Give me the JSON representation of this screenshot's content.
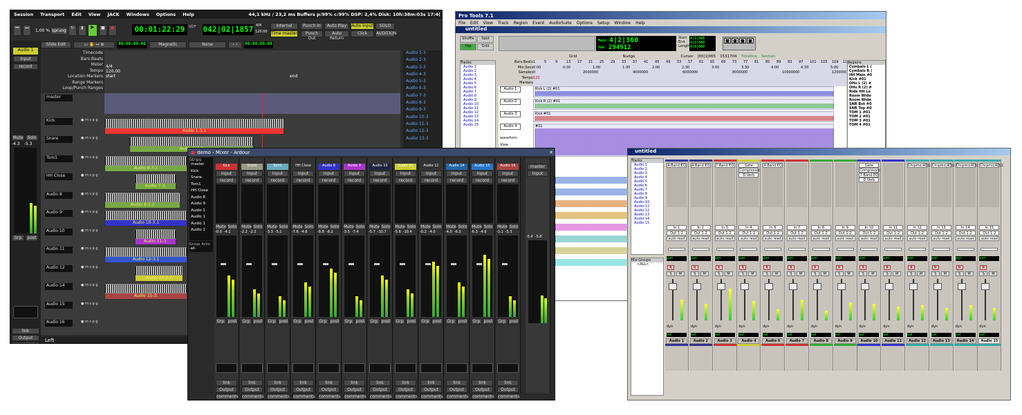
{
  "ardour": {
    "menu": [
      "Session",
      "Transport",
      "Edit",
      "View",
      "JACK",
      "Windows",
      "Options",
      "Help"
    ],
    "status": "44,1 kHz / 23,2 ms  Buffers p:99% c:99%  DSP:  2,4%  Disk: 10h:38m:03s 17:4(",
    "shuttle": "1,00 %",
    "shuttle_mode": "sprung",
    "clock1": "00:01:22:29",
    "clock2": "042|02|1857",
    "bpm_top": "4/4",
    "bpm": "120.00",
    "nudge": "NDF",
    "sync": "Internal",
    "time_master": "Time master",
    "punch_in": "Punch In",
    "punch_out": "Punch Out",
    "auto_play": "Auto Play",
    "auto_return": "Auto Return",
    "auto_input": "Auto Input",
    "click": "Click",
    "solo": "SOLO",
    "audition": "AUDITION",
    "edit_mode": "Slide Edit",
    "snap": "Magnetic",
    "snap_to": "None",
    "nudge_clock": "00:00:00:00",
    "nudge_clock2": "00:00:00:00",
    "rulers": [
      "Timecode",
      "Bars:Beats",
      "Meter",
      "Tempo",
      "Location Markers",
      "Range Markers",
      "Loop/Punch Ranges"
    ],
    "meter_val": "4/4",
    "tempo_val": "120.00",
    "start": "start",
    "end": "end",
    "tracks": [
      "master",
      "Kick",
      "Snare",
      "Tom1",
      "HH Close",
      "Audio 8",
      "Audio 9",
      "Audio 10",
      "Audio 11",
      "Audio 12",
      "Audio 14",
      "Audio 15",
      "Audio 16"
    ],
    "regions": [
      "Audio 1-3.1",
      "Audio 5-1.1",
      "Audio 6-3.1",
      "Audio 7-3.",
      "Audio 8-3.1",
      "Audio 10-3.1",
      "Audio 11-3.",
      "Audio 12-3.1",
      "Audio 14-3.1",
      "Audio 15-3."
    ],
    "side_tabs": [
      "Tracks/Busses",
      "Snapshots",
      "Edit Groups",
      "Chunks"
    ],
    "region_list": [
      "Audio 1-3",
      "Audio 2-3",
      "Audio 3-3",
      "Audio 4-3",
      "Audio 5-3",
      "Audio 6-3",
      "Audio 7-3",
      "Audio 8-3",
      "Audio 9-3",
      "Audio 10-3",
      "Audio 11-3",
      "Audio 12-3",
      "Audio 13-3"
    ],
    "left_strip": {
      "name": "Audio 1",
      "input": "Input",
      "record": "record",
      "mute": "Mute",
      "solo": "Solo",
      "gain": "-4.3",
      "peak": "-5.3",
      "grp": "Grp",
      "post": "post",
      "link": "link",
      "output": "Output",
      "comments": "comments"
    },
    "bottom": "Left"
  },
  "mixer": {
    "title": "demo - Mixer - Ardour",
    "strips_label": "Strips",
    "strips": [
      "master",
      "Kick",
      "Snare",
      "Tom1",
      "HH Close",
      "Audio 8",
      "Audio 9",
      "Audio 1",
      "Audio 1",
      "Audio 1",
      "Audio 1"
    ],
    "group": "Group",
    "active": "Activ",
    "all": "-all-",
    "channels": [
      {
        "n": "Kick",
        "c": "#c33"
      },
      {
        "n": "Snare",
        "c": "#998"
      },
      {
        "n": "Tom1",
        "c": "#6ab"
      },
      {
        "n": "HH Close",
        "c": "#333"
      },
      {
        "n": "Audio 8",
        "c": "#33c"
      },
      {
        "n": "Audio 9",
        "c": "#a3c"
      },
      {
        "n": "Audio 10",
        "c": "#224"
      },
      {
        "n": "Audio 11",
        "c": "#cc3"
      },
      {
        "n": "Audio 12",
        "c": "#333"
      },
      {
        "n": "Audio 14",
        "c": "#26a"
      },
      {
        "n": "Audio 15",
        "c": "#27c"
      },
      {
        "n": "Audio 16",
        "c": "#a44"
      }
    ],
    "gains": [
      "-0.0",
      "-2.2",
      "-3.3",
      "-7.6",
      "-8.8",
      "-3.5",
      "-5.7",
      "-5.6",
      "-0.2",
      "-4.0",
      "-6.3",
      "-3.1"
    ],
    "peaks": [
      "-4.1",
      "-2.2",
      "-5.1",
      "-4.6",
      "-8.2",
      "-7.4",
      "-10.7",
      "-10.4",
      "-4.0",
      "-6.3",
      "-4.9",
      "-5.3"
    ],
    "master_name": "master",
    "master_gain": "-5.4",
    "master_peak": "-5.8",
    "plug1": "(C) 3-band eq",
    "plug2": "(Gate)",
    "plug3": "(Gverb)",
    "input": "Input",
    "record": "record",
    "mute": "Mute",
    "solo": "Solo",
    "grp": "Grp",
    "post": "post",
    "link": "link",
    "output": "Output",
    "comments": "comments"
  },
  "protools": {
    "title": "Pro Tools 7.1",
    "menu": [
      "File",
      "Edit",
      "View",
      "Track",
      "Region",
      "Event",
      "AudioSuite",
      "Options",
      "Setup",
      "Window",
      "Help"
    ],
    "doc": "untitled",
    "modes": [
      "Shuffle",
      "Spot",
      "Slip",
      "Grid"
    ],
    "main_label": "Main",
    "sub_label": "Sub",
    "main_counter": "4|2|360",
    "sub_counter": "294912",
    "start_label": "Start",
    "end_label": "End",
    "length_label": "Length",
    "start": "4|2|360",
    "end": "4|2|360",
    "length": "0|0|000",
    "grid": "Grid",
    "nudge": "Nudge",
    "cursor": "Cursor",
    "cursor_val": "|65|1|065",
    "sample": "1531704",
    "timeline": "Timeline",
    "section": "Section",
    "tracks_label": "Tracks",
    "regions_label": "Regions",
    "tracklist": [
      "Audio 1",
      "Audio 2",
      "Audio 3",
      "Audio 4",
      "Audio 5",
      "Audio 6",
      "Audio 7",
      "Audio 8",
      "Audio 9",
      "Audio 10",
      "Audio 11",
      "Audio 12",
      "Audio 13",
      "Audio 14",
      "Audio 15"
    ],
    "rulers": [
      "Bars:Beats",
      "Min:Secs",
      "Samples",
      "Tempo",
      "Markers"
    ],
    "bars": [
      "1",
      "5",
      "9",
      "13",
      "17",
      "21",
      "25",
      "29",
      "33",
      "37",
      "41",
      "45",
      "49",
      "53",
      "57",
      "61",
      "65",
      "69",
      "73",
      "77",
      "81",
      "85",
      "89",
      "93",
      "97",
      "101",
      "105",
      "109",
      "113",
      "117",
      "121",
      "125",
      "129",
      "133",
      "137",
      "141",
      "145"
    ],
    "mins": [
      "0:00",
      "0:30",
      "1:00",
      "1:30",
      "2:00",
      "2:30",
      "3:00",
      "3:30",
      "4:00",
      "4:30",
      "5:00"
    ],
    "samples": [
      "0",
      "2000000",
      "4000000",
      "6000000",
      "8000000",
      "10000000",
      "12000000"
    ],
    "tempo": "120",
    "lanes": [
      {
        "n": "Audio 1",
        "r": "Kick L (2) #01",
        "c": "#33c"
      },
      {
        "n": "Audio 2",
        "r": "Kick R (2) #01",
        "c": "#3a3"
      },
      {
        "n": "Audio 3",
        "r": "Kick #01",
        "c": "#c22"
      },
      {
        "n": "Audio 4",
        "r": "#01",
        "c": "#63c"
      }
    ],
    "waveform": "waveform",
    "view": "View",
    "regions": [
      "Cymbals L (",
      "Cymbals R (",
      "HH Main #0",
      "Kick #01",
      "OHs L (2) #",
      "OHs R (2) #",
      "Ride HH Le",
      "Room Wide",
      "Room Wide",
      "SNR Bot #0",
      "SNR Top #0",
      "TOM 1 #01",
      "TOM 2 #01",
      "TOM 3 #01",
      "TOM 4 #01"
    ]
  },
  "ptmix": {
    "title": "untitled",
    "tracks_label": "Tracks",
    "mixgroups": "Mix Groups",
    "all": "<ALL>",
    "tracklist": [
      "Audio 1",
      "Audio 2",
      "Audio 3",
      "Audio 4",
      "Audio 5",
      "Audio 6",
      "Audio 7",
      "Audio 8",
      "Audio 9",
      "Audio 10",
      "Audio 11",
      "Audio 12",
      "Audio 13",
      "Audio 14",
      "Audio 15"
    ],
    "channels": [
      {
        "n": "Audio 1",
        "c": "#339",
        "i": [
          "4-Band EQ"
        ]
      },
      {
        "n": "Audio 2",
        "c": "#338",
        "i": [
          "4-Band EQ"
        ]
      },
      {
        "n": "Audio 3",
        "c": "#c33",
        "i": [
          "7-Band EQ"
        ]
      },
      {
        "n": "Audio 4",
        "c": "#cc3",
        "i": [
          "Gate",
          "Compressor",
          "D-Verb"
        ]
      },
      {
        "n": "Audio 6",
        "c": "#c33",
        "i": [
          "4-Band EQ"
        ]
      },
      {
        "n": "Audio 7",
        "c": "#c33",
        "i": []
      },
      {
        "n": "Audio 8",
        "c": "#3a3",
        "i": []
      },
      {
        "n": "Audio 9",
        "c": "#3a3",
        "i": []
      },
      {
        "n": "Audio 10",
        "c": "#33c",
        "i": [
          "Gate",
          "Compressor",
          "7-Band EQ",
          "D-Verb"
        ]
      },
      {
        "n": "Audio 11",
        "c": "#33c",
        "i": []
      },
      {
        "n": "Audio 12",
        "c": "#3aa",
        "i": [
          "Chrpms(4D)2"
        ]
      },
      {
        "n": "Audio 13",
        "c": "#3aa",
        "i": [
          "Chrpms(4D)2"
        ]
      },
      {
        "n": "Audio 14",
        "c": "#3aa",
        "i": [
          "Chrpms(4D)2"
        ]
      },
      {
        "n": "Audio 15",
        "c": "#3aa",
        "i": [
          "Chrpms(4D)2"
        ]
      }
    ],
    "ins": [
      "In 1",
      "In 2",
      "In 3",
      "In 4",
      "In 6",
      "In 7",
      "In 8",
      "In 9",
      "In 10",
      "In 11",
      "In 12",
      "In 13",
      "In 14",
      "In 15"
    ],
    "out": "Out 1-2",
    "auto": "auto read",
    "pan": "pan",
    "r": "R",
    "s": "S",
    "m": "M",
    "dyn": "dyn",
    "vol": "vol"
  },
  "colors": {
    "ardour_bg": "#2c2c2c",
    "pt_bg": "#d4d0c8",
    "accent_green": "#0f0",
    "timeline": "#b7b7c9"
  }
}
